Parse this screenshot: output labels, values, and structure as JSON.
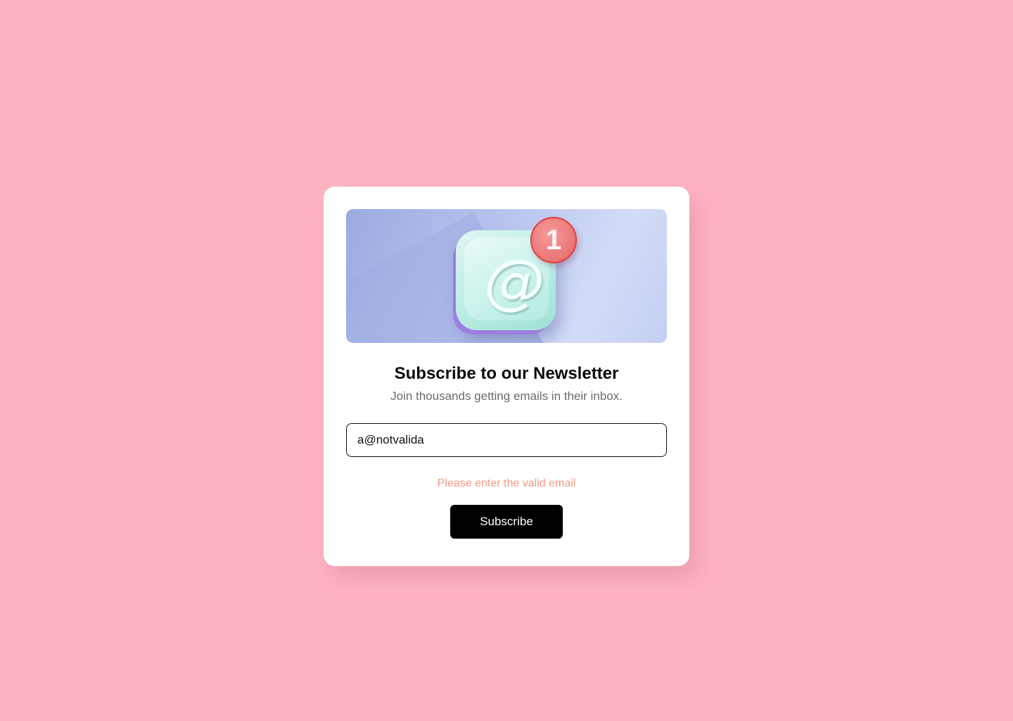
{
  "hero": {
    "icon": "at-sign-app-icon",
    "at_symbol": "@",
    "badge_count": "1"
  },
  "newsletter": {
    "title": "Subscribe to our Newsletter",
    "subtitle": "Join thousands getting emails in their inbox.",
    "email_value": "a@notvalida",
    "error_message": "Please enter the valid email",
    "subscribe_label": "Subscribe"
  },
  "colors": {
    "background": "#ffb3c2",
    "card": "#ffffff",
    "error": "#f39a80",
    "button": "#000000",
    "badge": "#ec7b7b"
  }
}
